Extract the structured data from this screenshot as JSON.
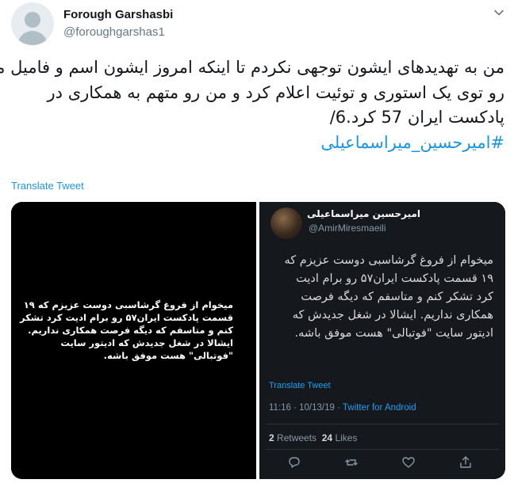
{
  "author": {
    "name": "Forough Garshasbi",
    "handle": "@foroughgarshas1"
  },
  "tweet": {
    "lines": [
      "من به تهدیدهای ایشون توجهی نکردم تا اینکه امروز ایشون اسم و فامیل من",
      "رو توی یک استوری و توئیت اعلام کرد و من رو متهم به همکاری در",
      "پادکست ایران 57 کرد.6/"
    ],
    "hashtag": "#امیرحسین_میراسماعیلی"
  },
  "translate_label": "Translate Tweet",
  "media": {
    "left_note": {
      "lines": [
        "میخوام از فروغ گرشاسبی دوست عزیزم که ۱۹",
        "قسمت پادکست ایران۵۷ رو برام ادیت کرد تشکر",
        "کنم و متاسفم که دیگه فرصت همکاری نداریم.",
        "ایشالا در شغل جدیدش که ادیتور سایت",
        "\"فوتبالی\" هست موفق باشه."
      ]
    },
    "embedded_tweet": {
      "name": "امیرحسین میراسماعیلی",
      "handle": "@AmirMiresmaeili",
      "lines": [
        "میخوام از فروغ گرشاسبی دوست عزیزم که",
        "۱۹ قسمت پادکست ایران۵۷ رو برام ادیت",
        "کرد تشکر کنم و متاسفم که دیگه فرصت",
        "همکاری نداریم. ایشالا در شغل جدیدش که",
        "ادیتور سایت \"فوتبالی\" هست موفق باشه."
      ],
      "translate_label": "Translate Tweet",
      "timestamp": "11:16 · 10/13/19 · ",
      "client": "Twitter for Android",
      "retweets_count": "2",
      "retweets_label": "Retweets",
      "likes_count": "24",
      "likes_label": "Likes"
    }
  },
  "icons": {
    "menu": "chevron-down-icon",
    "reply": "reply-icon",
    "retweet": "retweet-icon",
    "like": "heart-icon",
    "share": "share-icon"
  },
  "colors": {
    "link": "#1b95e0",
    "muted": "#657786",
    "dark_bg": "#15181c"
  }
}
